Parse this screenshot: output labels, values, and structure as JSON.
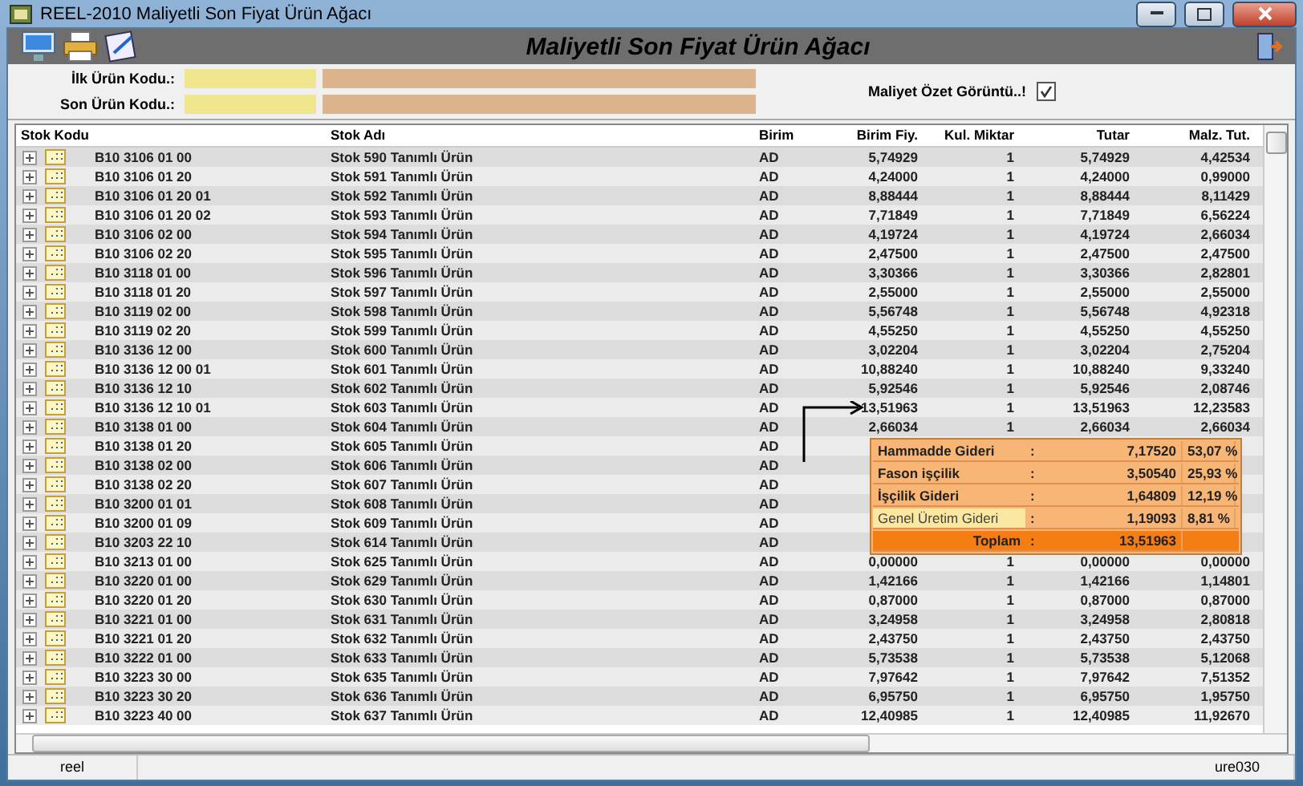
{
  "window": {
    "title": "REEL-2010 Maliyetli Son Fiyat Ürün Ağacı"
  },
  "header": {
    "title": "Maliyetli Son Fiyat Ürün Ağacı"
  },
  "form": {
    "first_code_label": "İlk Ürün Kodu.:",
    "last_code_label": "Son Ürün Kodu.:",
    "summary_label": "Maliyet Özet Görüntü..!",
    "summary_checked": true
  },
  "table": {
    "columns": [
      "Stok Kodu",
      "Stok Adı",
      "Birim",
      "Birim Fiy.",
      "Kul. Miktar",
      "Tutar",
      "Malz. Tut."
    ],
    "rows": [
      {
        "code": "B10 3106 01 00",
        "name": "Stok 590 Tanımlı Ürün",
        "unit": "AD",
        "price": "5,74929",
        "qty": "1",
        "total": "5,74929",
        "material": "4,42534"
      },
      {
        "code": "B10 3106 01 20",
        "name": "Stok 591 Tanımlı Ürün",
        "unit": "AD",
        "price": "4,24000",
        "qty": "1",
        "total": "4,24000",
        "material": "0,99000"
      },
      {
        "code": "B10 3106 01 20 01",
        "name": "Stok 592 Tanımlı Ürün",
        "unit": "AD",
        "price": "8,88444",
        "qty": "1",
        "total": "8,88444",
        "material": "8,11429"
      },
      {
        "code": "B10 3106 01 20 02",
        "name": "Stok 593 Tanımlı Ürün",
        "unit": "AD",
        "price": "7,71849",
        "qty": "1",
        "total": "7,71849",
        "material": "6,56224"
      },
      {
        "code": "B10 3106 02 00",
        "name": "Stok 594 Tanımlı Ürün",
        "unit": "AD",
        "price": "4,19724",
        "qty": "1",
        "total": "4,19724",
        "material": "2,66034"
      },
      {
        "code": "B10 3106 02 20",
        "name": "Stok 595 Tanımlı Ürün",
        "unit": "AD",
        "price": "2,47500",
        "qty": "1",
        "total": "2,47500",
        "material": "2,47500"
      },
      {
        "code": "B10 3118 01 00",
        "name": "Stok 596 Tanımlı Ürün",
        "unit": "AD",
        "price": "3,30366",
        "qty": "1",
        "total": "3,30366",
        "material": "2,82801"
      },
      {
        "code": "B10 3118 01 20",
        "name": "Stok 597 Tanımlı Ürün",
        "unit": "AD",
        "price": "2,55000",
        "qty": "1",
        "total": "2,55000",
        "material": "2,55000"
      },
      {
        "code": "B10 3119 02 00",
        "name": "Stok 598 Tanımlı Ürün",
        "unit": "AD",
        "price": "5,56748",
        "qty": "1",
        "total": "5,56748",
        "material": "4,92318"
      },
      {
        "code": "B10 3119 02 20",
        "name": "Stok 599 Tanımlı Ürün",
        "unit": "AD",
        "price": "4,55250",
        "qty": "1",
        "total": "4,55250",
        "material": "4,55250"
      },
      {
        "code": "B10 3136 12 00",
        "name": "Stok 600 Tanımlı Ürün",
        "unit": "AD",
        "price": "3,02204",
        "qty": "1",
        "total": "3,02204",
        "material": "2,75204"
      },
      {
        "code": "B10 3136 12 00 01",
        "name": "Stok 601 Tanımlı Ürün",
        "unit": "AD",
        "price": "10,88240",
        "qty": "1",
        "total": "10,88240",
        "material": "9,33240"
      },
      {
        "code": "B10 3136 12 10",
        "name": "Stok 602 Tanımlı Ürün",
        "unit": "AD",
        "price": "5,92546",
        "qty": "1",
        "total": "5,92546",
        "material": "2,08746"
      },
      {
        "code": "B10 3136 12 10 01",
        "name": "Stok 603 Tanımlı Ürün",
        "unit": "AD",
        "price": "13,51963",
        "qty": "1",
        "total": "13,51963",
        "material": "12,23583"
      },
      {
        "code": "B10 3138 01 00",
        "name": "Stok 604 Tanımlı Ürün",
        "unit": "AD",
        "price": "2,66034",
        "qty": "1",
        "total": "2,66034",
        "material": "2,66034"
      },
      {
        "code": "B10 3138 01 20",
        "name": "Stok 605 Tanımlı Ürün",
        "unit": "AD"
      },
      {
        "code": "B10 3138 02 00",
        "name": "Stok 606 Tanımlı Ürün",
        "unit": "AD"
      },
      {
        "code": "B10 3138 02 20",
        "name": "Stok 607 Tanımlı Ürün",
        "unit": "AD"
      },
      {
        "code": "B10 3200 01 01",
        "name": "Stok 608 Tanımlı Ürün",
        "unit": "AD"
      },
      {
        "code": "B10 3200 01 09",
        "name": "Stok 609 Tanımlı Ürün",
        "unit": "AD"
      },
      {
        "code": "B10 3203 22 10",
        "name": "Stok 614 Tanımlı Ürün",
        "unit": "AD"
      },
      {
        "code": "B10 3213 01 00",
        "name": "Stok 625 Tanımlı Ürün",
        "unit": "AD",
        "price": "0,00000",
        "qty": "1",
        "total": "0,00000",
        "material": "0,00000"
      },
      {
        "code": "B10 3220 01 00",
        "name": "Stok 629 Tanımlı Ürün",
        "unit": "AD",
        "price": "1,42166",
        "qty": "1",
        "total": "1,42166",
        "material": "1,14801"
      },
      {
        "code": "B10 3220 01 20",
        "name": "Stok 630 Tanımlı Ürün",
        "unit": "AD",
        "price": "0,87000",
        "qty": "1",
        "total": "0,87000",
        "material": "0,87000"
      },
      {
        "code": "B10 3221 01 00",
        "name": "Stok 631 Tanımlı Ürün",
        "unit": "AD",
        "price": "3,24958",
        "qty": "1",
        "total": "3,24958",
        "material": "2,80818"
      },
      {
        "code": "B10 3221 01 20",
        "name": "Stok 632 Tanımlı Ürün",
        "unit": "AD",
        "price": "2,43750",
        "qty": "1",
        "total": "2,43750",
        "material": "2,43750"
      },
      {
        "code": "B10 3222 01 00",
        "name": "Stok 633 Tanımlı Ürün",
        "unit": "AD",
        "price": "5,73538",
        "qty": "1",
        "total": "5,73538",
        "material": "5,12068"
      },
      {
        "code": "B10 3223 30 00",
        "name": "Stok 635 Tanımlı Ürün",
        "unit": "AD",
        "price": "7,97642",
        "qty": "1",
        "total": "7,97642",
        "material": "7,51352"
      },
      {
        "code": "B10 3223 30 20",
        "name": "Stok 636 Tanımlı Ürün",
        "unit": "AD",
        "price": "6,95750",
        "qty": "1",
        "total": "6,95750",
        "material": "1,95750"
      },
      {
        "code": "B10 3223 40 00",
        "name": "Stok 637 Tanımlı Ürün",
        "unit": "AD",
        "price": "12,40985",
        "qty": "1",
        "total": "12,40985",
        "material": "11,92670"
      }
    ]
  },
  "cost_popup": {
    "items": [
      {
        "label": "Hammadde Gideri",
        "colon": ":",
        "value": "7,17520",
        "percent": "53,07 %",
        "selected": false
      },
      {
        "label": "Fason işçilik",
        "colon": ":",
        "value": "3,50540",
        "percent": "25,93 %",
        "selected": false
      },
      {
        "label": "İşçilik Gideri",
        "colon": ":",
        "value": "1,64809",
        "percent": "12,19 %",
        "selected": false
      },
      {
        "label": "Genel Üretim Gideri",
        "colon": ":",
        "value": "1,19093",
        "percent": "8,81 %",
        "selected": true
      }
    ],
    "total": {
      "label": "Toplam",
      "colon": ":",
      "value": "13,51963"
    }
  },
  "status_bar": {
    "left": "reel",
    "right": "ure030"
  }
}
